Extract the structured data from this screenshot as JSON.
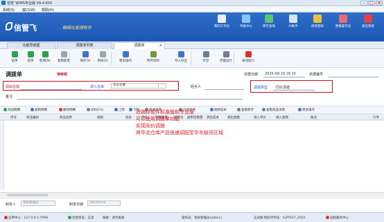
{
  "window": {
    "title": "信管飞RMS专业版 V9.4.650",
    "min": "−",
    "max": "□",
    "close": "×"
  },
  "menu": [
    "系统(S)",
    "窗口(W)",
    "帮助(H)"
  ],
  "banner": {
    "logo": "信管飞",
    "slogan": "精细化管理软件",
    "items": [
      {
        "label": "我的工作台",
        "color": "#ffffff"
      },
      {
        "label": "单据中心",
        "color": "#8fd3ff"
      },
      {
        "label": "库存查询",
        "color": "#5fd16a"
      },
      {
        "label": "AI助手",
        "color": "#e9f2ff"
      },
      {
        "label": "修改密码",
        "color": "#ffcc33"
      },
      {
        "label": "更换操作员",
        "color": "#ff6a6a"
      },
      {
        "label": "退出系统",
        "color": "#ff3b30"
      }
    ]
  },
  "tabs": [
    {
      "label": "功能导航图"
    },
    {
      "label": "调拨单列表"
    },
    {
      "label": "调拨单",
      "close": "×"
    }
  ],
  "toolbar": [
    {
      "label": "前单",
      "color": "#2e9e4f"
    },
    {
      "label": "后单",
      "color": "#2e9e4f"
    },
    {
      "label": "新增(N)",
      "color": "#2e9e4f"
    },
    {
      "label": "复制新增",
      "color": "#9aa6b2"
    },
    {
      "label": "保存(S)",
      "color": "#3b74c9"
    },
    {
      "label": "审核(A)",
      "color": "#9aa6b2"
    },
    {
      "label": "更多操作",
      "color": "#3b74c9"
    },
    {
      "label": "附件资料",
      "color": "#6a9c3a"
    },
    {
      "label": "导入导出",
      "color": "#3b74c9"
    },
    {
      "label": "打印",
      "color": "#6f7f92"
    },
    {
      "label": "界面设计",
      "color": "#6f7f92"
    },
    {
      "label": "关闭窗口",
      "color": "#d9342b"
    }
  ],
  "form": {
    "title": "调拨单",
    "status": "待审核",
    "date_label": "单据日期",
    "date_value": "2025-09-19 16:15",
    "no_label": "单据编号",
    "no_value": "",
    "out_wh_label": "调出仓库",
    "out_wh_value": "",
    "in_wh_label": "调入仓库",
    "in_wh_value": "华东仓库",
    "in_wh_btn": "···",
    "handler_label": "经手人",
    "handler_value": "",
    "type_label": "调拨类型",
    "type_value": "同价调拨",
    "memo_label": "备注",
    "memo_value": ""
  },
  "gridtools": [
    {
      "label": "添加明细",
      "color": "#2e9e4f"
    },
    {
      "label": "复制明细",
      "color": "#3b74c9"
    },
    {
      "label": "删除明细",
      "color": "#d9342b"
    },
    {
      "label": "扫码(F4)",
      "color": "#6f7f92"
    },
    {
      "label": "上移",
      "color": "#3b74c9"
    },
    {
      "label": "下移",
      "color": "#3b74c9"
    },
    {
      "label": "快速排序",
      "color": "#6f7f92"
    },
    {
      "label": "只读风格",
      "color": "#6f7f92"
    },
    {
      "label": "刷新成本",
      "color": "#3b74c9"
    },
    {
      "label": "查看库存",
      "color": "#6f7f92"
    },
    {
      "label": "查看商品详情",
      "color": "#6f7f92"
    },
    {
      "label": "更多操作",
      "color": "#3b74c9"
    }
  ],
  "columns": [
    "序号",
    "商品编码",
    "商品名称",
    "规格",
    "批号",
    "单位",
    "调拨数量",
    "副单位",
    "副单位数量",
    "调出成本",
    "调出金额",
    "调入单价",
    "调入金额",
    "备注",
    "引单"
  ],
  "annotation": [
    "进销存软件标准版和专业版",
    "可以使用调拨单功能",
    "实现同价调拨",
    "将华北仓库产品快速调配至华东缺货区域"
  ],
  "footer": {
    "maker_label": "制单人",
    "maker_value": "系统管理员",
    "make_date_label": "制单日期",
    "make_date_value": "2025/9/19"
  },
  "statusbar": [
    {
      "label": "应用中心：127.0.0.1:7099",
      "color": "#d9342b"
    },
    {
      "label": "连接状态：正常",
      "color": "#2e9e4f"
    },
    {
      "label": "账套：演示账套",
      "color": ""
    },
    {
      "label": "操作员：系统管理员(admin)",
      "color": ""
    },
    {
      "label": "正式版  授权序列号：IGPTEST_2022",
      "color": ""
    },
    {
      "label": "远程服务中心",
      "color": "#d9342b"
    }
  ]
}
